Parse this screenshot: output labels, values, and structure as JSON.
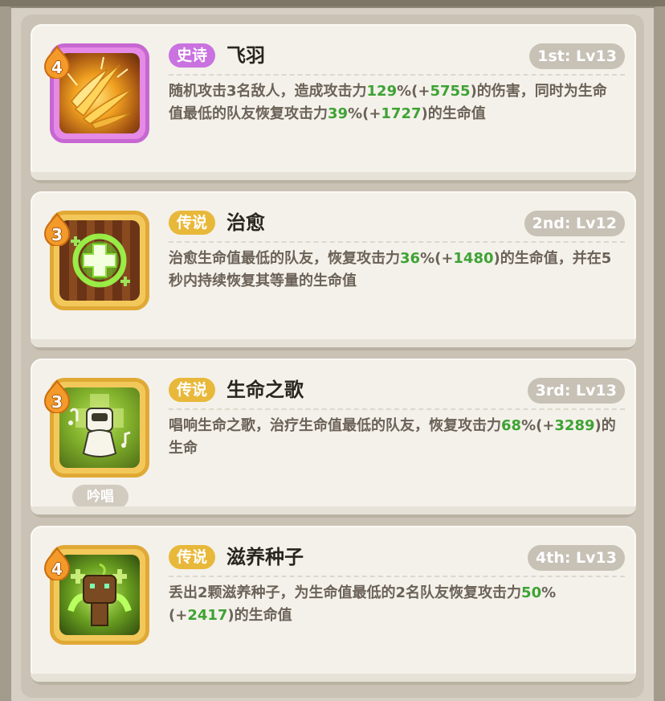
{
  "skills": [
    {
      "rarity": "史诗",
      "rarity_color": "#c972e0",
      "name": "飞羽",
      "level": "1st: Lv13",
      "star": "4",
      "icon": "feather-burst-icon",
      "desc": {
        "p1": "随机攻击3名敌人，造成攻击力",
        "v1": "129",
        "p2": "%(+",
        "v2": "5755",
        "p3": ")的伤害，同时为生命值最低的队友恢复攻击力",
        "v3": "39",
        "p4": "%(+",
        "v4": "1727",
        "p5": ")的生命值"
      }
    },
    {
      "rarity": "传说",
      "rarity_color": "#e8b83a",
      "name": "治愈",
      "level": "2nd: Lv12",
      "star": "3",
      "icon": "green-cross-heal-icon",
      "desc": {
        "p1": "治愈生命值最低的队友，恢复攻击力",
        "v1": "36",
        "p2": "%(+",
        "v2": "1480",
        "p3": ")的生命值，并在5秒内持续恢复其等量的生命值"
      }
    },
    {
      "rarity": "传说",
      "rarity_color": "#e8b83a",
      "name": "生命之歌",
      "level": "3rd: Lv13",
      "star": "3",
      "icon": "singing-character-icon",
      "tag": "吟唱",
      "desc": {
        "p1": "唱响生命之歌，治疗生命值最低的队友，恢复攻击力",
        "v1": "68",
        "p2": "%(+",
        "v2": "3289",
        "p3": ")的生命"
      }
    },
    {
      "rarity": "传说",
      "rarity_color": "#e8b83a",
      "name": "滋养种子",
      "level": "4th: Lv13",
      "star": "4",
      "icon": "seed-sprout-icon",
      "desc": {
        "p1": "丢出2颗滋养种子，为生命值最低的2名队友恢复攻击力",
        "v1": "50",
        "p2": "%(+",
        "v2": "2417",
        "p3": ")的生命值"
      }
    }
  ]
}
